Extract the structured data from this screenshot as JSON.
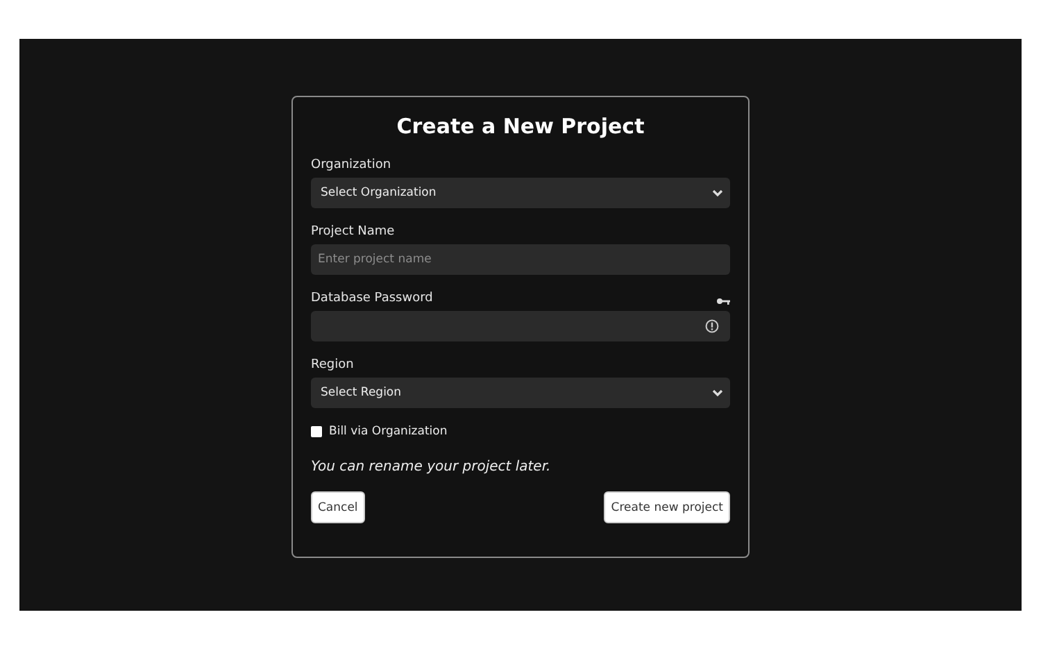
{
  "title": "Create a New Project",
  "fields": [
    {
      "kind": "select",
      "label": "Organization",
      "value": "Select Organization"
    },
    {
      "kind": "text",
      "label": "Project Name",
      "placeholder": "Enter project name"
    },
    {
      "kind": "password",
      "label": "Database Password"
    },
    {
      "kind": "select",
      "label": "Region",
      "value": "Select Region"
    }
  ],
  "checkbox": {
    "label": "Bill via Organization",
    "checked": false
  },
  "note": "You can rename your project later.",
  "buttons": [
    {
      "label": "Cancel"
    },
    {
      "label": "Create new project"
    }
  ]
}
